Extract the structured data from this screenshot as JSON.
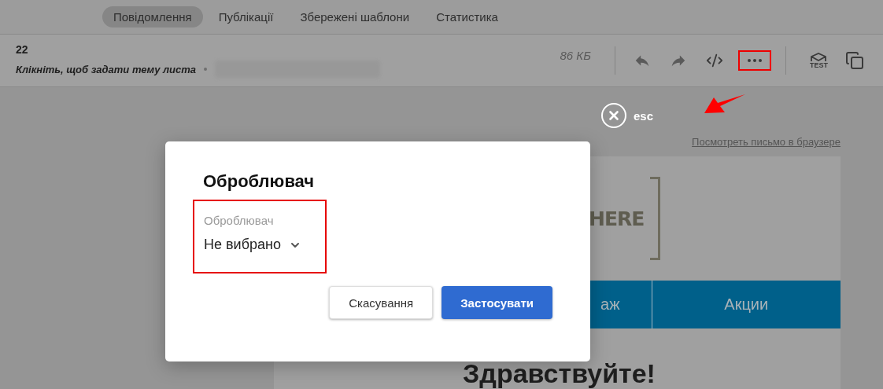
{
  "nav": {
    "tabs": [
      {
        "label": "Повідомлення",
        "selected": true
      },
      {
        "label": "Публікації",
        "selected": false
      },
      {
        "label": "Збережені шаблони",
        "selected": false
      },
      {
        "label": "Статистика",
        "selected": false
      }
    ]
  },
  "message": {
    "number": "22",
    "subject": "Клікніть, щоб задати тему листа",
    "size": "86 КБ",
    "tools": [
      {
        "kind": "divider"
      },
      {
        "kind": "undo",
        "highlighted": false
      },
      {
        "kind": "redo",
        "highlighted": false
      },
      {
        "kind": "code",
        "highlighted": false
      },
      {
        "kind": "more",
        "highlighted": true
      },
      {
        "kind": "divider"
      },
      {
        "kind": "test",
        "label": "TEST",
        "highlighted": false
      },
      {
        "kind": "copy",
        "highlighted": false
      }
    ]
  },
  "close": {
    "label": "esc"
  },
  "preview": {
    "browser_link": "Посмотреть письмо в браузере",
    "logo_text": "HERE",
    "menu": [
      "аж",
      "Акции"
    ],
    "greeting": "Здравствуйте!"
  },
  "dialog": {
    "title": "Оброблювач",
    "field": {
      "label": "Оброблювач",
      "value": "Не вибрано",
      "highlighted": true
    },
    "buttons": [
      {
        "label": "Скасування",
        "kind": "secondary"
      },
      {
        "label": "Застосувати",
        "kind": "primary"
      }
    ]
  }
}
